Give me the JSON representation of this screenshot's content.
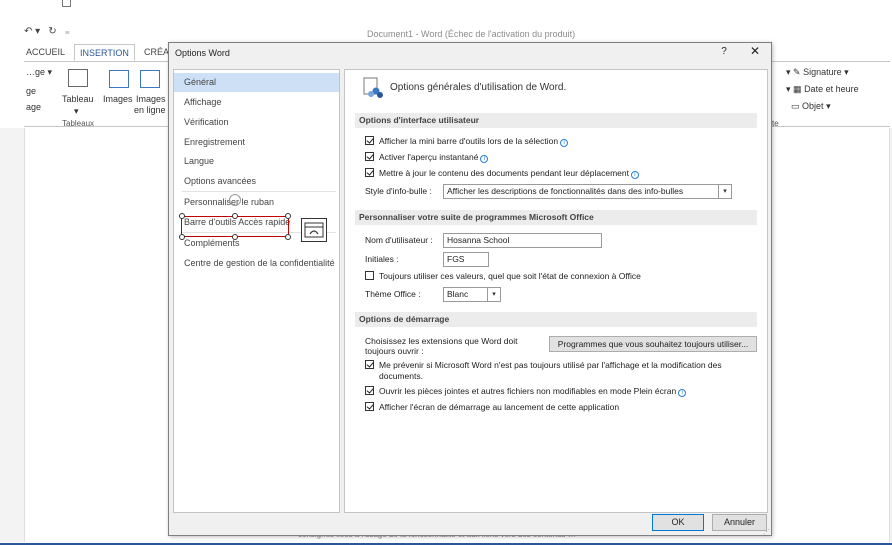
{
  "word": {
    "window_title": "Document1 - Word (Échec de l'activation du produit)",
    "qat_undo": "↶ ▾",
    "qat_redo": "↻",
    "qat_more": "₌",
    "tabs": [
      "ACCUEIL",
      "INSERTION",
      "CRÉAT"
    ],
    "ribbon_left": {
      "l1": "ge",
      "l2": "age",
      "t1": "…ge ▾"
    },
    "ribbon_buttons": {
      "tableau": "Tableau",
      "images": "Images",
      "images_en_ligne_1": "Images",
      "images_en_ligne_2": "en ligne"
    },
    "group_tableaux": "Tableaux",
    "ribbon_right": {
      "signature": "Signature",
      "date_heure": "Date et heure",
      "objet": "Objet",
      "group_suffix": "xte"
    },
    "doc_bottom_text": "consignes liées à l'usage de la fonctionnalité et aux liens vers des contenus …"
  },
  "dialog": {
    "title": "Options Word",
    "help": "?",
    "close": "✕",
    "nav": [
      "Général",
      "Affichage",
      "Vérification",
      "Enregistrement",
      "Langue",
      "Options avancées",
      "Personnaliser le ruban",
      "Barre d'outils Accès rapide",
      "Compléments",
      "Centre de gestion de la confidentialité"
    ],
    "header": "Options générales d'utilisation de Word.",
    "sections": {
      "interface": "Options d'interface utilisateur",
      "personalize": "Personnaliser votre suite de programmes Microsoft Office",
      "startup": "Options de démarrage"
    },
    "ui_options": {
      "mini_toolbar": "Afficher la mini barre d'outils lors de la sélection",
      "live_preview": "Activer l'aperçu instantané",
      "update_drag": "Mettre à jour le contenu des documents pendant leur déplacement",
      "tooltip_label": "Style d'info-bulle :",
      "tooltip_value": "Afficher les descriptions de fonctionnalités dans des info-bulles"
    },
    "personalize": {
      "username_label": "Nom d'utilisateur :",
      "username_value": "Hosanna School",
      "initials_label": "Initiales :",
      "initials_value": "FGS",
      "always_use": "Toujours utiliser ces valeurs, quel que soit l'état de connexion à Office",
      "theme_label": "Thème Office :",
      "theme_value": "Blanc"
    },
    "startup": {
      "extensions_label_1": "Choisissez les extensions que Word doit",
      "extensions_label_2": "toujours ouvrir :",
      "programs_button": "Programmes que vous souhaitez toujours utiliser...",
      "warn_1": "Me prévenir si Microsoft Word n'est pas toujours utilisé par l'affichage et la modification des",
      "warn_2": "documents.",
      "open_attachments": "Ouvrir les pièces jointes et autres fichiers non modifiables en mode Plein écran",
      "splash": "Afficher l'écran de démarrage au lancement de cette application"
    },
    "ok": "OK",
    "cancel": "Annuler"
  },
  "colors": {
    "accent": "#2b579a",
    "selection": "#cde0f5",
    "highlight_box": "#c00000",
    "default_button": "#0078d7"
  }
}
